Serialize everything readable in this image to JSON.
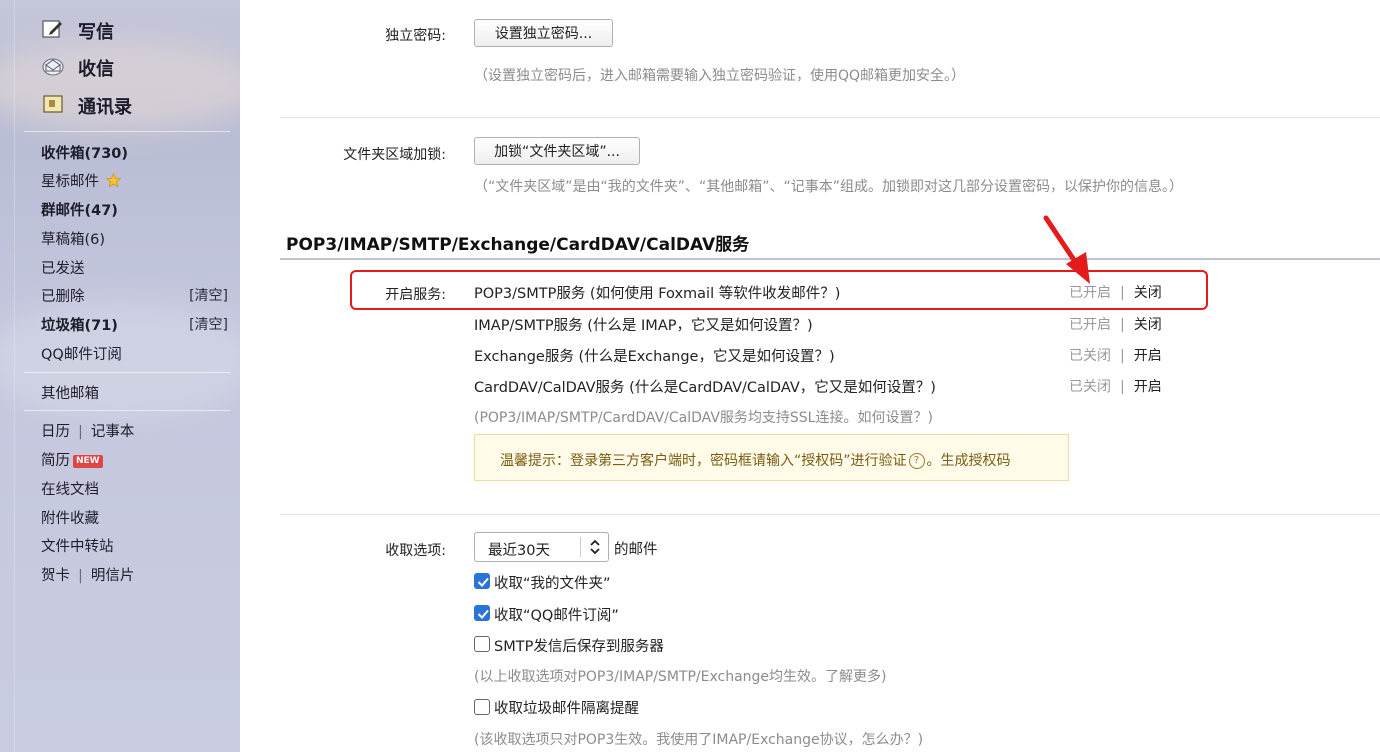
{
  "sidebar": {
    "compose": "写信",
    "receive": "收信",
    "contacts": "通讯录",
    "folders": [
      {
        "label": "收件箱(730)",
        "bold": true
      },
      {
        "label": "星标邮件",
        "bold": false
      },
      {
        "label": "群邮件(47)",
        "bold": true
      },
      {
        "label": "草稿箱(6)",
        "bold": false
      },
      {
        "label": "已发送",
        "bold": false
      },
      {
        "label": "已删除",
        "bold": false,
        "action": "[清空]"
      },
      {
        "label": "垃圾箱(71)",
        "bold": true,
        "action": "[清空]"
      },
      {
        "label": "QQ邮件订阅",
        "bold": false
      }
    ],
    "other_mail": "其他邮箱",
    "calendar": "日历",
    "notes": "记事本",
    "resume": "简历",
    "new_badge": "NEW",
    "online_docs": "在线文档",
    "attachments": "附件收藏",
    "file_transfer": "文件中转站",
    "greeting_card": "贺卡",
    "postcard": "明信片"
  },
  "main": {
    "independent_password": {
      "label": "独立密码:",
      "button": "设置独立密码...",
      "hint": "（设置独立密码后，进入邮箱需要输入独立密码验证，使用QQ邮箱更加安全。）"
    },
    "folder_lock": {
      "label": "文件夹区域加锁:",
      "button": "加锁“文件夹区域”...",
      "hint": "（“文件夹区域”是由“我的文件夹”、“其他邮箱”、“记事本”组成。加锁即对这几部分设置密码，以保护你的信息。）"
    },
    "services_section": {
      "title": "POP3/IMAP/SMTP/Exchange/CardDAV/CalDAV服务",
      "label": "开启服务:",
      "services": [
        {
          "name": "POP3/SMTP服务 (如何使用 Foxmail 等软件收发邮件？)",
          "status": "已开启",
          "action": "关闭"
        },
        {
          "name": "IMAP/SMTP服务 (什么是 IMAP，它又是如何设置？)",
          "status": "已开启",
          "action": "关闭"
        },
        {
          "name": "Exchange服务 (什么是Exchange，它又是如何设置？)",
          "status": "已关闭",
          "action": "开启"
        },
        {
          "name": "CardDAV/CalDAV服务 (什么是CardDAV/CalDAV，它又是如何设置？)",
          "status": "已关闭",
          "action": "开启"
        }
      ],
      "ssl_hint": "(POP3/IMAP/SMTP/CardDAV/CalDAV服务均支持SSL连接。如何设置？)",
      "tip": "温馨提示：登录第三方客户端时，密码框请输入“授权码”进行验证",
      "tip_icon": "?",
      "tip_link": "。生成授权码"
    },
    "fetch": {
      "label": "收取选项:",
      "select_value": "最近30天",
      "after_select": "的邮件",
      "options": [
        {
          "label": "收取“我的文件夹”",
          "checked": true
        },
        {
          "label": "收取“QQ邮件订阅”",
          "checked": true
        },
        {
          "label": "SMTP发信后保存到服务器",
          "checked": false
        }
      ],
      "options_hint": "(以上收取选项对POP3/IMAP/SMTP/Exchange均生效。了解更多)",
      "spam_option": {
        "label": "收取垃圾邮件隔离提醒",
        "checked": false
      },
      "spam_hint": "(该收取选项只对POP3生效。我使用了IMAP/Exchange协议，怎么办？)"
    }
  },
  "colors": {
    "highlight_red": "#e31b1b",
    "checkbox_blue": "#2a74d8",
    "tip_background": "#fffbe8"
  }
}
